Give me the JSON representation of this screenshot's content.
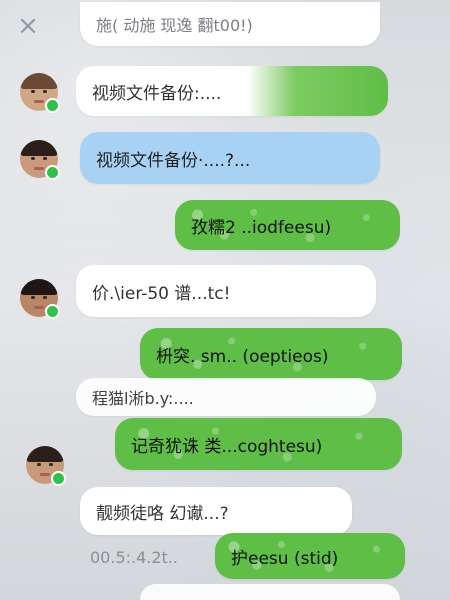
{
  "header": {
    "close_icon": "×",
    "top_text": "施( 动施    现逸 翻t00!)"
  },
  "messages": [
    {
      "text": "视频文件备份:....",
      "style": "white-with-green"
    },
    {
      "text": "视频文件备份·....?...",
      "style": "blue"
    },
    {
      "text": "孜糯2 ..iodfeesu)",
      "style": "green"
    },
    {
      "text": "价.\\ier-50 谱...tc!",
      "style": "white"
    },
    {
      "text": "枡突. sm.. (oeptieos)",
      "style": "green"
    },
    {
      "text": "程猫l淅b.y:....",
      "style": "white"
    },
    {
      "text": "记奇犹诛 类...coghtesu)",
      "style": "green"
    },
    {
      "text": "靓频徒咯   幻谳...?",
      "style": "white"
    },
    {
      "text": "00.5:.4.2t..",
      "style": "time"
    },
    {
      "text": "护eesu (stid)",
      "style": "green"
    }
  ],
  "icons": {
    "close": "close-icon",
    "online": "online-dot-icon"
  },
  "colors": {
    "green_bubble": "#5fbe46",
    "blue_bubble": "#a8d2f3",
    "white_bubble": "#ffffff",
    "online_dot": "#2fc24a"
  }
}
